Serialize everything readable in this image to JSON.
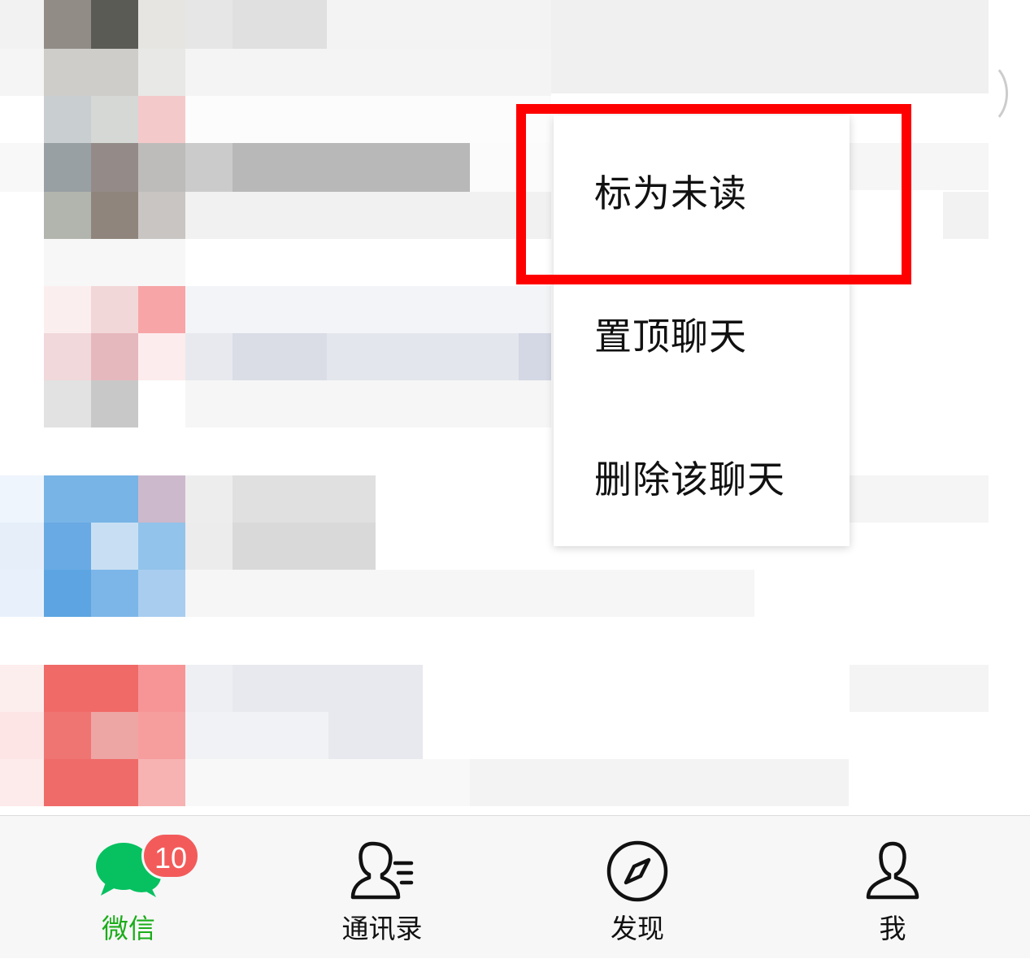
{
  "context_menu": {
    "items": [
      "标为未读",
      "置顶聊天",
      "删除该聊天"
    ],
    "highlighted_item": "标为未读",
    "highlight_color": "#ff0000"
  },
  "tab_bar": {
    "tabs": [
      {
        "label": "微信",
        "icon": "chat-bubbles-icon",
        "active": true,
        "badge": "10"
      },
      {
        "label": "通讯录",
        "icon": "contacts-icon",
        "active": false
      },
      {
        "label": "发现",
        "icon": "compass-icon",
        "active": false
      },
      {
        "label": "我",
        "icon": "person-icon",
        "active": false
      }
    ],
    "active_color": "#07c160",
    "badge_color": "#f35b5b"
  }
}
